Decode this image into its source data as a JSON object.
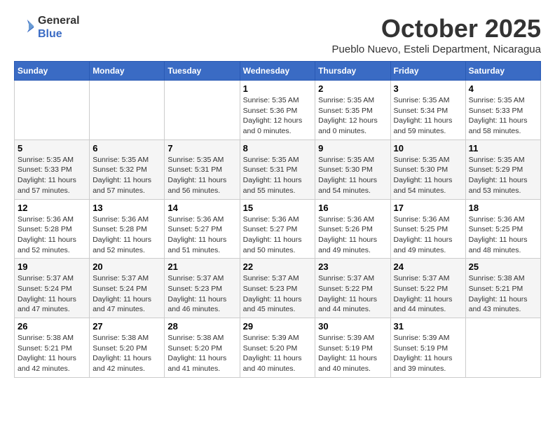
{
  "logo": {
    "general": "General",
    "blue": "Blue"
  },
  "title": {
    "month": "October 2025",
    "location": "Pueblo Nuevo, Esteli Department, Nicaragua"
  },
  "weekdays": [
    "Sunday",
    "Monday",
    "Tuesday",
    "Wednesday",
    "Thursday",
    "Friday",
    "Saturday"
  ],
  "weeks": [
    [
      {
        "day": null,
        "info": null
      },
      {
        "day": null,
        "info": null
      },
      {
        "day": null,
        "info": null
      },
      {
        "day": "1",
        "info": "Sunrise: 5:35 AM\nSunset: 5:36 PM\nDaylight: 12 hours\nand 0 minutes."
      },
      {
        "day": "2",
        "info": "Sunrise: 5:35 AM\nSunset: 5:35 PM\nDaylight: 12 hours\nand 0 minutes."
      },
      {
        "day": "3",
        "info": "Sunrise: 5:35 AM\nSunset: 5:34 PM\nDaylight: 11 hours\nand 59 minutes."
      },
      {
        "day": "4",
        "info": "Sunrise: 5:35 AM\nSunset: 5:33 PM\nDaylight: 11 hours\nand 58 minutes."
      }
    ],
    [
      {
        "day": "5",
        "info": "Sunrise: 5:35 AM\nSunset: 5:33 PM\nDaylight: 11 hours\nand 57 minutes."
      },
      {
        "day": "6",
        "info": "Sunrise: 5:35 AM\nSunset: 5:32 PM\nDaylight: 11 hours\nand 57 minutes."
      },
      {
        "day": "7",
        "info": "Sunrise: 5:35 AM\nSunset: 5:31 PM\nDaylight: 11 hours\nand 56 minutes."
      },
      {
        "day": "8",
        "info": "Sunrise: 5:35 AM\nSunset: 5:31 PM\nDaylight: 11 hours\nand 55 minutes."
      },
      {
        "day": "9",
        "info": "Sunrise: 5:35 AM\nSunset: 5:30 PM\nDaylight: 11 hours\nand 54 minutes."
      },
      {
        "day": "10",
        "info": "Sunrise: 5:35 AM\nSunset: 5:30 PM\nDaylight: 11 hours\nand 54 minutes."
      },
      {
        "day": "11",
        "info": "Sunrise: 5:35 AM\nSunset: 5:29 PM\nDaylight: 11 hours\nand 53 minutes."
      }
    ],
    [
      {
        "day": "12",
        "info": "Sunrise: 5:36 AM\nSunset: 5:28 PM\nDaylight: 11 hours\nand 52 minutes."
      },
      {
        "day": "13",
        "info": "Sunrise: 5:36 AM\nSunset: 5:28 PM\nDaylight: 11 hours\nand 52 minutes."
      },
      {
        "day": "14",
        "info": "Sunrise: 5:36 AM\nSunset: 5:27 PM\nDaylight: 11 hours\nand 51 minutes."
      },
      {
        "day": "15",
        "info": "Sunrise: 5:36 AM\nSunset: 5:27 PM\nDaylight: 11 hours\nand 50 minutes."
      },
      {
        "day": "16",
        "info": "Sunrise: 5:36 AM\nSunset: 5:26 PM\nDaylight: 11 hours\nand 49 minutes."
      },
      {
        "day": "17",
        "info": "Sunrise: 5:36 AM\nSunset: 5:25 PM\nDaylight: 11 hours\nand 49 minutes."
      },
      {
        "day": "18",
        "info": "Sunrise: 5:36 AM\nSunset: 5:25 PM\nDaylight: 11 hours\nand 48 minutes."
      }
    ],
    [
      {
        "day": "19",
        "info": "Sunrise: 5:37 AM\nSunset: 5:24 PM\nDaylight: 11 hours\nand 47 minutes."
      },
      {
        "day": "20",
        "info": "Sunrise: 5:37 AM\nSunset: 5:24 PM\nDaylight: 11 hours\nand 47 minutes."
      },
      {
        "day": "21",
        "info": "Sunrise: 5:37 AM\nSunset: 5:23 PM\nDaylight: 11 hours\nand 46 minutes."
      },
      {
        "day": "22",
        "info": "Sunrise: 5:37 AM\nSunset: 5:23 PM\nDaylight: 11 hours\nand 45 minutes."
      },
      {
        "day": "23",
        "info": "Sunrise: 5:37 AM\nSunset: 5:22 PM\nDaylight: 11 hours\nand 44 minutes."
      },
      {
        "day": "24",
        "info": "Sunrise: 5:37 AM\nSunset: 5:22 PM\nDaylight: 11 hours\nand 44 minutes."
      },
      {
        "day": "25",
        "info": "Sunrise: 5:38 AM\nSunset: 5:21 PM\nDaylight: 11 hours\nand 43 minutes."
      }
    ],
    [
      {
        "day": "26",
        "info": "Sunrise: 5:38 AM\nSunset: 5:21 PM\nDaylight: 11 hours\nand 42 minutes."
      },
      {
        "day": "27",
        "info": "Sunrise: 5:38 AM\nSunset: 5:20 PM\nDaylight: 11 hours\nand 42 minutes."
      },
      {
        "day": "28",
        "info": "Sunrise: 5:38 AM\nSunset: 5:20 PM\nDaylight: 11 hours\nand 41 minutes."
      },
      {
        "day": "29",
        "info": "Sunrise: 5:39 AM\nSunset: 5:20 PM\nDaylight: 11 hours\nand 40 minutes."
      },
      {
        "day": "30",
        "info": "Sunrise: 5:39 AM\nSunset: 5:19 PM\nDaylight: 11 hours\nand 40 minutes."
      },
      {
        "day": "31",
        "info": "Sunrise: 5:39 AM\nSunset: 5:19 PM\nDaylight: 11 hours\nand 39 minutes."
      },
      {
        "day": null,
        "info": null
      }
    ]
  ]
}
